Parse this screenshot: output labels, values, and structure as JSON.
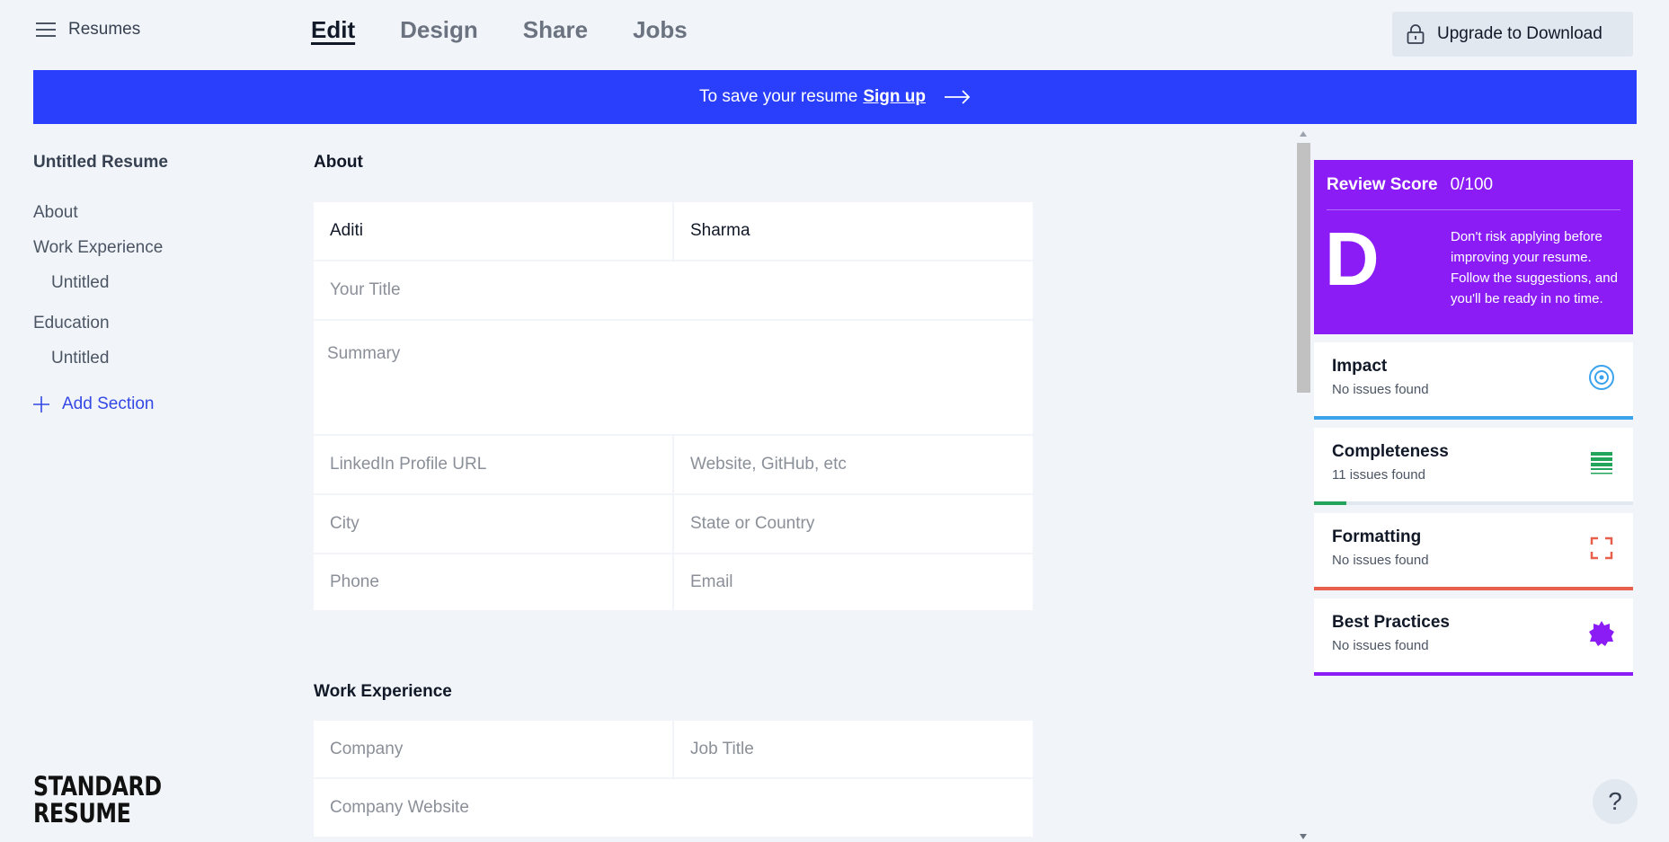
{
  "header": {
    "menu_label": "Resumes",
    "tabs": [
      {
        "label": "Edit",
        "active": true
      },
      {
        "label": "Design",
        "active": false
      },
      {
        "label": "Share",
        "active": false
      },
      {
        "label": "Jobs",
        "active": false
      }
    ],
    "upgrade_label": "Upgrade to Download"
  },
  "banner": {
    "text": "To save your resume",
    "link": "Sign up",
    "color": "#2a3ffb"
  },
  "sidebar": {
    "title": "Untitled Resume",
    "items": [
      {
        "label": "About"
      },
      {
        "label": "Work Experience"
      },
      {
        "label": "Untitled"
      },
      {
        "label": "Education"
      },
      {
        "label": "Untitled"
      }
    ],
    "add_section": "Add Section"
  },
  "logo": {
    "line1": "STANDARD",
    "line2": "RESUME"
  },
  "about": {
    "heading": "About",
    "first_name": "Aditi",
    "last_name": "Sharma",
    "title_placeholder": "Your Title",
    "summary_placeholder": "Summary",
    "linkedin_placeholder": "LinkedIn Profile URL",
    "website_placeholder": "Website, GitHub, etc",
    "city_placeholder": "City",
    "state_placeholder": "State or Country",
    "phone_placeholder": "Phone",
    "email_placeholder": "Email"
  },
  "work": {
    "heading": "Work Experience",
    "company_placeholder": "Company",
    "job_title_placeholder": "Job Title",
    "company_website_placeholder": "Company Website"
  },
  "review": {
    "label": "Review Score",
    "score": "0/100",
    "grade": "D",
    "message": "Don't risk applying before improving your resume. Follow the suggestions, and you'll be ready in no time.",
    "color": "#8b1cf5",
    "metrics": [
      {
        "name": "Impact",
        "status": "No issues found",
        "icon": "target-icon",
        "color": "#3ba3ec",
        "progress": 1.0
      },
      {
        "name": "Completeness",
        "status": "11 issues found",
        "icon": "list-icon",
        "color": "#22a55b",
        "progress": 0.1
      },
      {
        "name": "Formatting",
        "status": "No issues found",
        "icon": "frame-corners-icon",
        "color": "#e8604c",
        "progress": 1.0
      },
      {
        "name": "Best Practices",
        "status": "No issues found",
        "icon": "badge-star-icon",
        "color": "#8b1cf5",
        "progress": 1.0
      }
    ]
  },
  "help": {
    "label": "?"
  }
}
